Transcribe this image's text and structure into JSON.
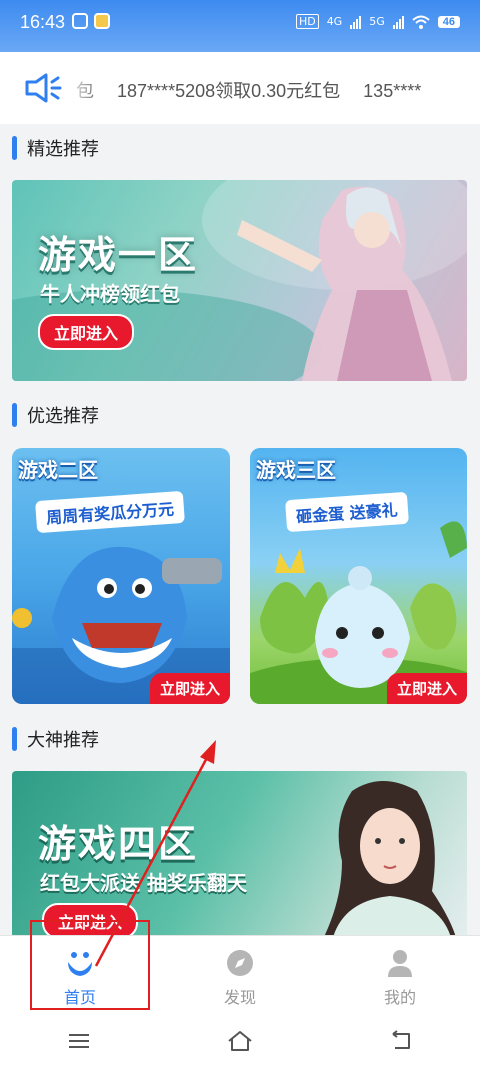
{
  "status_bar": {
    "time": "16:43",
    "network_label": "HD",
    "signal_1": "4G",
    "signal_2": "5G",
    "battery": "46"
  },
  "notice": {
    "icon": "speaker-icon",
    "items": [
      "包",
      "187****5208领取0.30元红包",
      "135****"
    ]
  },
  "sections": {
    "featured": "精选推荐",
    "preferred": "优选推荐",
    "master": "大神推荐"
  },
  "banners": {
    "zone1": {
      "title": "游戏一区",
      "subtitle": "牛人冲榜领红包",
      "button": "立即进入"
    },
    "zone2": {
      "title": "游戏二区",
      "tag": "周周有奖瓜分万元",
      "button": "立即进入"
    },
    "zone3": {
      "title": "游戏三区",
      "tag": "砸金蛋 送豪礼",
      "button": "立即进入"
    },
    "zone4": {
      "title": "游戏四区",
      "subtitle": "红包大派送 抽奖乐翻天",
      "button": "立即进入"
    }
  },
  "bottom_nav": [
    {
      "label": "首页",
      "icon": "home-smile-icon",
      "active": true
    },
    {
      "label": "发现",
      "icon": "compass-icon",
      "active": false
    },
    {
      "label": "我的",
      "icon": "user-icon",
      "active": false
    }
  ],
  "colors": {
    "accent": "#2f7ff0",
    "button_red": "#e8192c",
    "annotation_red": "#e02020"
  }
}
